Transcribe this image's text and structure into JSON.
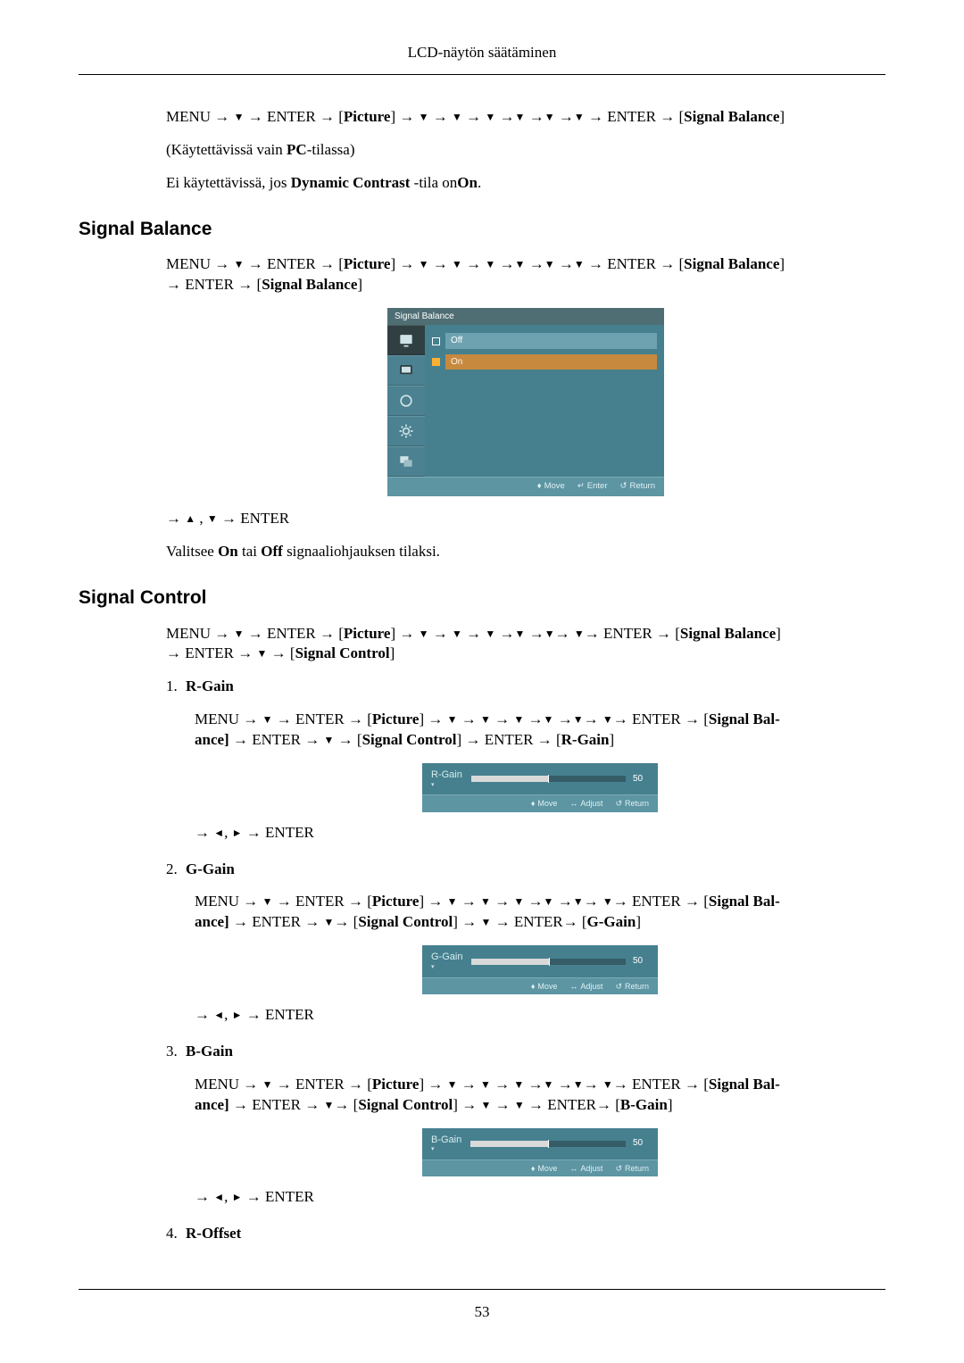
{
  "header": {
    "title": "LCD-näytön säätäminen"
  },
  "pageNumber": "53",
  "glyph": {
    "down": "▼",
    "up": "▲",
    "left": "◄",
    "right": "►"
  },
  "intro": {
    "path_pre": "MENU → ",
    "enter_arrow_open": " → ENTER → [",
    "picture": "Picture",
    "close_arrow": "] → ",
    "enter_arrow": " → ENTER → [",
    "signal_balance": "Signal Balance",
    "close": "]",
    "note1_a": "(Käytettävissä vain ",
    "note1_b": "PC",
    "note1_c": "-tilassa)",
    "note2_a": "Ei käytettävissä, jos ",
    "note2_b": "Dynamic Contrast",
    "note2_c": " -tila on",
    "note2_d": "On",
    "note2_e": "."
  },
  "sec1": {
    "heading": "Signal Balance",
    "path_line2_a": " → ENTER → [",
    "path_line2_b": "Signal Balance",
    "path_line2_c": "]",
    "after_a": "→ ",
    "after_b": " , ",
    "after_c": " → ENTER",
    "desc_a": "Valitsee ",
    "desc_on": "On",
    "desc_mid": " tai ",
    "desc_off": "Off",
    "desc_end": " signaaliohjauksen tilaksi."
  },
  "osd": {
    "title": "Signal Balance",
    "opt_off": "Off",
    "opt_on": "On",
    "foot_move": "Move",
    "foot_enter": "Enter",
    "foot_return": "Return"
  },
  "sec2": {
    "heading": "Signal Control",
    "line2_a": " → ENTER → ",
    "line2_b": " → [",
    "line2_c": "Signal Control",
    "line2_d": "]",
    "items": [
      {
        "num": "1.",
        "label": "R-Gain",
        "path2_a": " → ENTER → ",
        "path2_b": " → [",
        "path2_c": "Signal Control",
        "path2_d": "] → ENTER → [",
        "path2_e": "R-Gain",
        "path2_f": "]",
        "mini_label": "R-Gain",
        "mini_val": "50"
      },
      {
        "num": "2.",
        "label": "G-Gain",
        "path2_a": " → ENTER → ",
        "path2_b": "→ [",
        "path2_c": "Signal Control",
        "path2_d": "] → ",
        "path2_d2": " → ENTER→ [",
        "path2_e": "G-Gain",
        "path2_f": "]",
        "mini_label": "G-Gain",
        "mini_val": "50"
      },
      {
        "num": "3.",
        "label": "B-Gain",
        "path2_a": " → ENTER → ",
        "path2_b": "→ [",
        "path2_c": "Signal Control",
        "path2_d": "] → ",
        "path2_d2": " → ",
        "path2_d3": " → ENTER→ [",
        "path2_e": "B-Gain",
        "path2_f": "]",
        "mini_label": "B-Gain",
        "mini_val": "50"
      },
      {
        "num": "4.",
        "label": "R-Offset"
      }
    ],
    "after_lr_enter": " → ENTER",
    "between": ", ",
    "foot_adjust": "Adjust"
  },
  "sb_prefix": "Signal Bal-",
  "sb_suffix": "ance] "
}
